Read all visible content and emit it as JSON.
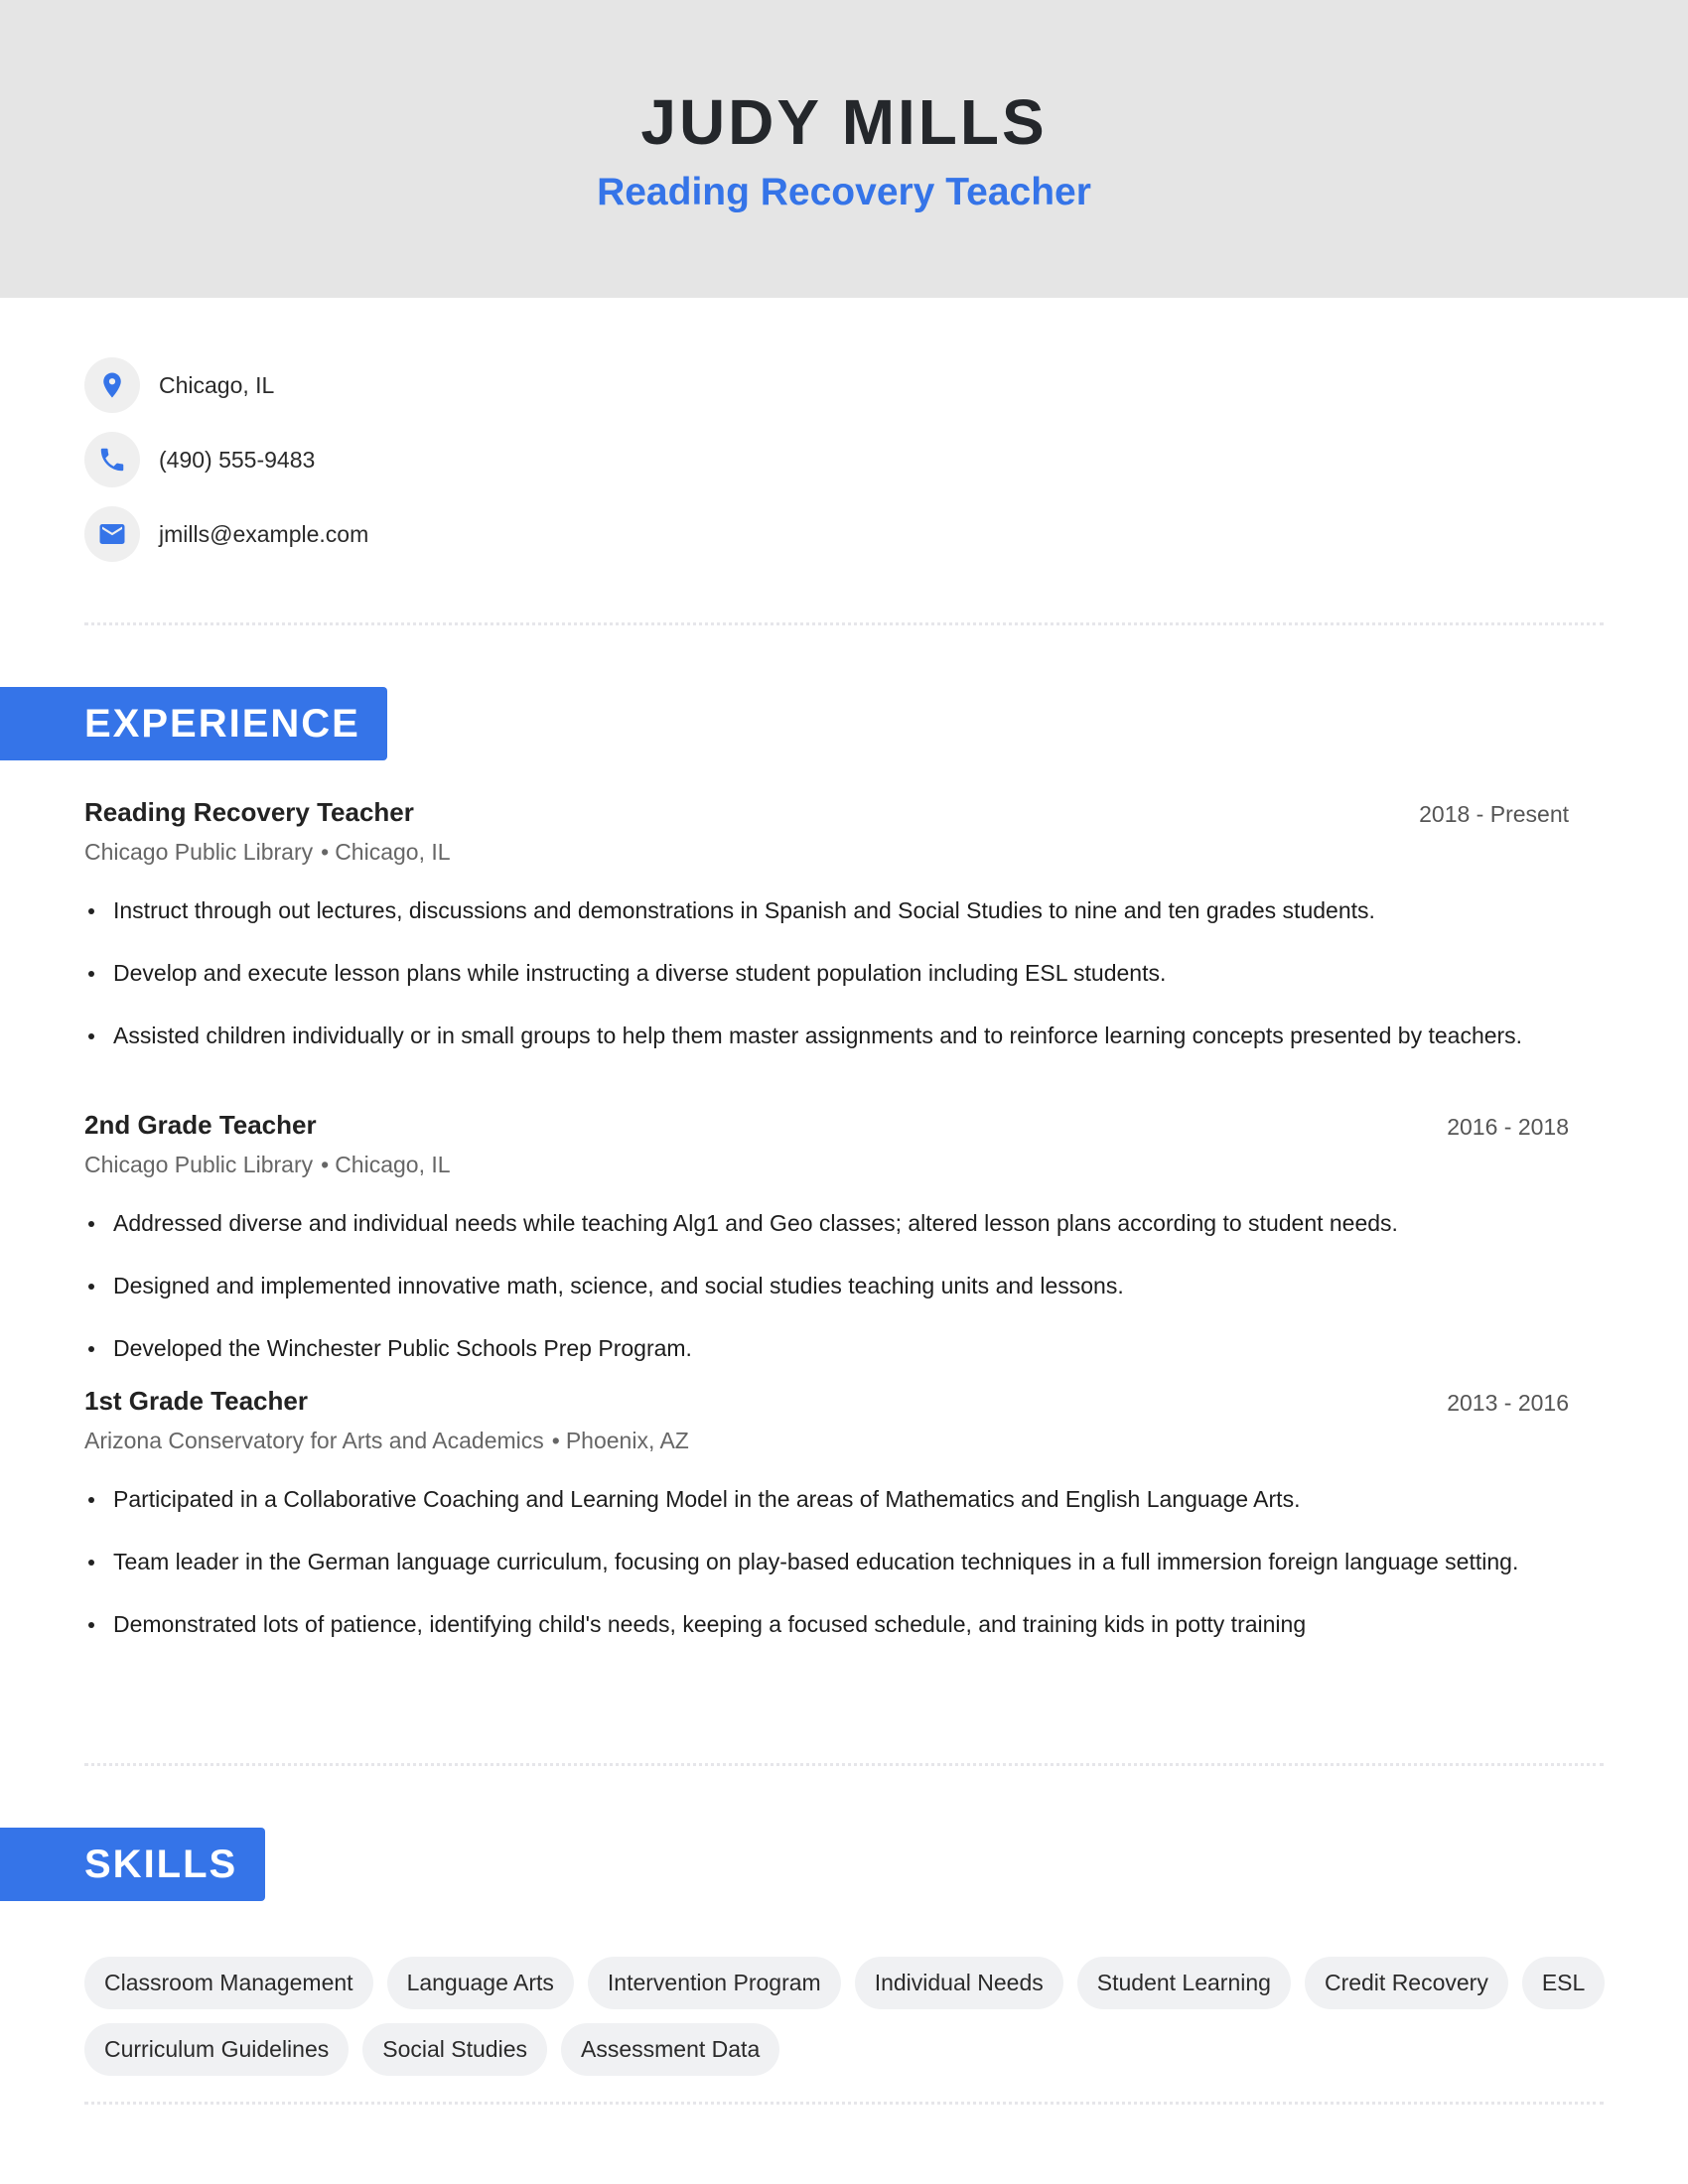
{
  "header": {
    "name": "JUDY MILLS",
    "title": "Reading Recovery Teacher"
  },
  "contact": {
    "location": "Chicago, IL",
    "phone": "(490) 555-9483",
    "email": "jmills@example.com",
    "icons": [
      "location-pin-icon",
      "phone-icon",
      "email-icon"
    ]
  },
  "colors": {
    "accent": "#3574e8",
    "header_bg": "#e5e5e5",
    "chip_bg": "#f0f1f3"
  },
  "experience": {
    "heading": "EXPERIENCE",
    "jobs": [
      {
        "title": "Reading Recovery Teacher",
        "dates": "2018 - Present",
        "company": "Chicago Public Library",
        "location": "Chicago, IL",
        "bullets": [
          "Instruct through out lectures, discussions and demonstrations in Spanish and Social Studies to nine and ten grades students.",
          "Develop and execute lesson plans while instructing a diverse student population including ESL students.",
          "Assisted children individually or in small groups to help them master assignments and to reinforce learning concepts presented by teachers."
        ]
      },
      {
        "title": "2nd Grade Teacher",
        "dates": "2016 - 2018",
        "company": "Chicago Public Library",
        "location": "Chicago, IL",
        "bullets": [
          "Addressed diverse and individual needs while teaching Alg1 and Geo classes; altered lesson plans according to student needs.",
          "Designed and implemented innovative math, science, and social studies teaching units and lessons.",
          "Developed the Winchester Public Schools Prep Program."
        ]
      },
      {
        "title": "1st Grade Teacher",
        "dates": "2013 - 2016",
        "company": "Arizona Conservatory for Arts and Academics",
        "location": "Phoenix, AZ",
        "bullets": [
          "Participated in a Collaborative Coaching and Learning Model in the areas of Mathematics and English Language Arts.",
          "Team leader in the German language curriculum, focusing on play-based education techniques in a full immersion foreign language setting.",
          "Demonstrated lots of patience, identifying child's needs, keeping a focused schedule, and training kids in potty training"
        ]
      }
    ]
  },
  "skills": {
    "heading": "SKILLS",
    "items": [
      "Classroom Management",
      "Language Arts",
      "Intervention Program",
      "Individual Needs",
      "Student Learning",
      "Credit Recovery",
      "ESL",
      "Curriculum Guidelines",
      "Social Studies",
      "Assessment Data"
    ]
  }
}
